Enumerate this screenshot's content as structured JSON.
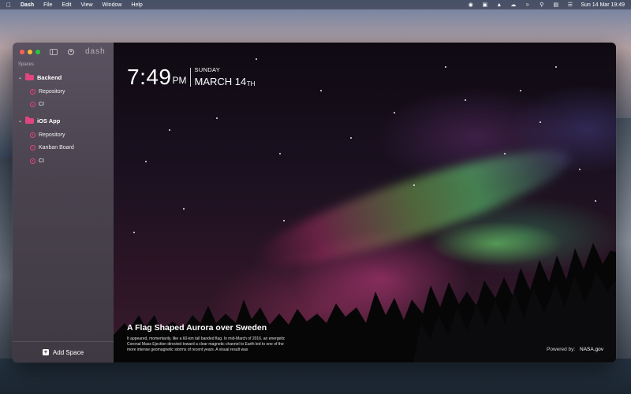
{
  "menubar": {
    "app_name": "Dash",
    "menus": [
      "File",
      "Edit",
      "View",
      "Window",
      "Help"
    ],
    "datetime": "Sun 14 Mar  19:49"
  },
  "window": {
    "brand": "dash",
    "sidebar": {
      "section_label": "Spaces",
      "spaces": [
        {
          "name": "Backend",
          "items": [
            "Repository",
            "CI"
          ]
        },
        {
          "name": "iOS App",
          "items": [
            "Repository",
            "Kanban Board",
            "CI"
          ]
        }
      ],
      "add_space_label": "Add Space"
    },
    "clock": {
      "time": "7:49",
      "ampm": "PM",
      "weekday": "SUNDAY",
      "date": "MARCH 14",
      "suffix": "TH"
    },
    "photo": {
      "title": "A Flag Shaped Aurora over Sweden",
      "caption": "It appeared, momentarily, like a 60-km tall banded flag. In mid-March of 2016, an energetic Coronal Mass Ejection directed toward a clear magnetic channel to Earth led to one of the more intense geomagnetic storms of recent years. A visual result was",
      "powered_label": "Powered by:",
      "powered_source": "NASA.gov"
    }
  }
}
